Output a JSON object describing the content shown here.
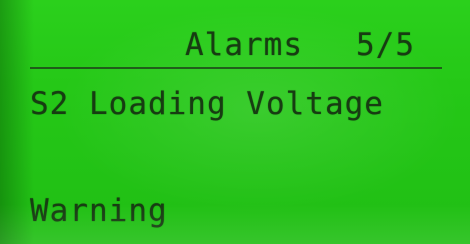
{
  "screen": {
    "title": "Alarms",
    "page_indicator": "5/5",
    "alarm_message": "S2 Loading Voltage",
    "alarm_severity": "Warning"
  },
  "colors": {
    "lcd_background": "#25c817",
    "lcd_text": "#173c12"
  }
}
